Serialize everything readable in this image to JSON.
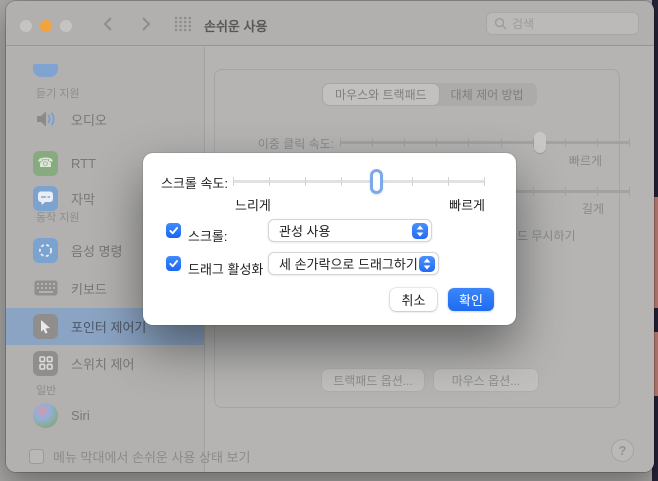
{
  "colors": {
    "accent_blue": "#2473f4",
    "dialog_bg": "#ffffff",
    "window_dim_bg": "#b5b4b3",
    "sidebar_selection": "#8ba4c3",
    "traffic_minimize": "#f2a43c",
    "slider_knob_ring": "#7ca9ea",
    "desktop_navy": "#262239",
    "desktop_salmon": "#c5837b"
  },
  "titlebar": {
    "title": "손쉬운 사용",
    "search_placeholder": "검색"
  },
  "sidebar": {
    "sections": [
      {
        "label": "듣기 지원"
      },
      {
        "label": "동작 지원"
      },
      {
        "label": "일반"
      }
    ],
    "items": [
      {
        "label": "오디오",
        "icon": "audio-speaker-icon"
      },
      {
        "label": "RTT",
        "icon": "rtt-phone-icon"
      },
      {
        "label": "자막",
        "icon": "captions-bubble-icon"
      },
      {
        "label": "음성 명령",
        "icon": "voice-control-icon"
      },
      {
        "label": "키보드",
        "icon": "keyboard-icon"
      },
      {
        "label": "포인터 제어기",
        "icon": "pointer-cursor-icon",
        "selected": true
      },
      {
        "label": "스위치 제어",
        "icon": "switch-control-icon"
      },
      {
        "label": "Siri",
        "icon": "siri-orb-icon"
      }
    ]
  },
  "main": {
    "tabs": [
      {
        "label": "마우스와 트랙패드",
        "selected": true
      },
      {
        "label": "대체 제어 방법",
        "selected": false
      }
    ],
    "double_click_label": "이중 클릭 속도:",
    "fast_label": "빠르게",
    "long_label": "길게",
    "ignore_fragment": "드 무시하기",
    "double_click_slider": {
      "position_percent": 69
    },
    "trackpad_options_label": "트랙패드 옵션...",
    "mouse_options_label": "마우스 옵션..."
  },
  "dialog": {
    "scroll_speed_label": "스크롤 속도:",
    "slow_label": "느리게",
    "fast_label": "빠르게",
    "slider": {
      "ticks": 8,
      "selected_tick_index": 4,
      "position_percent": 57
    },
    "rows": [
      {
        "checkbox_label": "스크롤:",
        "checked": true,
        "popup_value": "관성 사용"
      },
      {
        "checkbox_label": "드래그 활성화",
        "checked": true,
        "popup_value": "세 손가락으로 드래그하기"
      }
    ],
    "cancel_label": "취소",
    "ok_label": "확인"
  },
  "footer": {
    "menu_checkbox_label": "메뉴 막대에서 손쉬운 사용 상태 보기",
    "menu_checkbox_checked": false,
    "help_label": "?"
  }
}
